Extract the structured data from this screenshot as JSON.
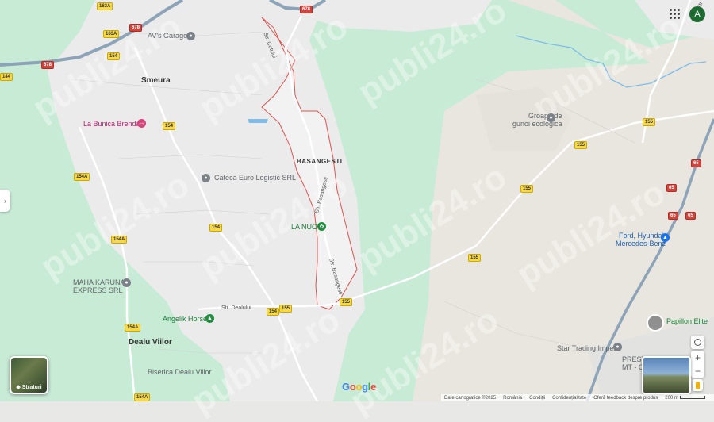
{
  "places": {
    "smeura": "Smeura",
    "basangesti": "BASANGESTI",
    "dealu_viilor": "Dealu Viilor"
  },
  "pois": {
    "avs_garage": "AV's Garage",
    "la_bunica_brenda": "La Bunica Brenda",
    "cateca": "Cateca Euro Logistic SRL",
    "la_nuc": "LA NUC",
    "maha_karuna_1": "MAHA KARUNA",
    "maha_karuna_2": "EXPRESS SRL",
    "angelik_horse": "Angelik Horse",
    "biserica": "Biserica Dealu Viilor",
    "groapa_1": "Groapa de",
    "groapa_2": "gunoi ecologica",
    "ford_1": "Ford, Hyundai,",
    "ford_2": "Mercedes-Benz",
    "papillon": "Papillon Elite",
    "star_trading": "Star Trading Impex",
    "prest_1": "PREST",
    "prest_2": "MT - CARO"
  },
  "streets": {
    "cutului": "Str. Cutului",
    "basangesti_1": "Str. Basangesti",
    "basangesti_2": "Str. Basangesti",
    "dealului": "Str. Dealului",
    "octa": "Str. Octa"
  },
  "road_shields": {
    "s163a_top": "163A",
    "s163a_2": "163A",
    "s678_a": "678",
    "s678_b": "678",
    "s678_c": "678",
    "s144": "144",
    "s154_a": "154",
    "s154_b": "154",
    "s154_c": "154",
    "s154_d": "154",
    "s154a_a": "154A",
    "s154a_b": "154A",
    "s154a_c": "154A",
    "s154a_d": "154A",
    "s155_a": "155",
    "s155_b": "155",
    "s155_c": "155",
    "s155_d": "155",
    "s155_e": "155",
    "s155_f": "155",
    "s65_a": "65",
    "s65_b": "65",
    "s65_c": "65",
    "s65_d": "65"
  },
  "watermark_text": "publi24.ro",
  "controls": {
    "layers_label": "Straturi",
    "avatar_letter": "A",
    "zoom_in": "+",
    "zoom_out": "−",
    "side_toggle": "›"
  },
  "footer": {
    "map_data": "Date cartografice ©2025",
    "country": "România",
    "terms": "Condiții",
    "privacy": "Confidențialitate",
    "feedback": "Oferă feedback despre produs",
    "scale": "200 m"
  },
  "brand": {
    "google_letters": [
      "G",
      "o",
      "o",
      "g",
      "l",
      "e"
    ],
    "google_colors": [
      "#4285f4",
      "#ea4335",
      "#fbbc05",
      "#4285f4",
      "#34a853",
      "#ea4335"
    ]
  },
  "colors": {
    "forest": "#c8ebd6",
    "urban": "#ebebeb",
    "field": "#e8e6df",
    "road": "#8da4b8",
    "boundary": "#d9534f",
    "water": "#7fbde8"
  }
}
